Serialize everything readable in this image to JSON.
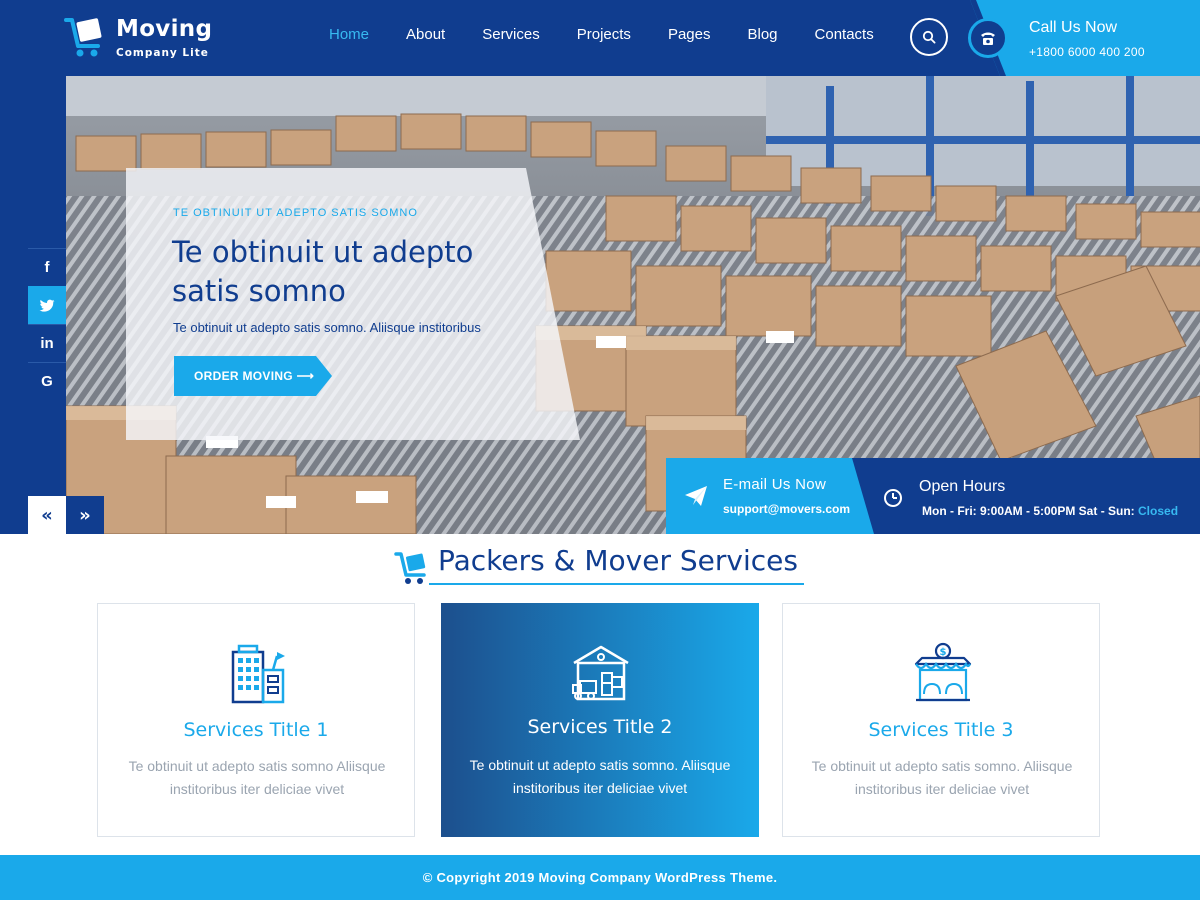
{
  "brand": {
    "name": "Moving",
    "tagline": "Company Lite"
  },
  "nav": {
    "items": [
      "Home",
      "About",
      "Services",
      "Projects",
      "Pages",
      "Blog",
      "Contacts"
    ],
    "active": "Home"
  },
  "call": {
    "title": "Call Us Now",
    "number": "+1800 6000 400 200"
  },
  "social": [
    "facebook-icon",
    "twitter-icon",
    "linkedin-icon",
    "google-icon"
  ],
  "hero": {
    "kicker": "TE OBTINUIT UT ADEPTO SATIS SOMNO",
    "title": "Te obtinuit ut adepto satis somno",
    "text": "Te obtinuit ut adepto satis somno. Aliisque institoribus",
    "button": "ORDER MOVING ⟶"
  },
  "info": {
    "email_title": "E-mail Us Now",
    "email_value": "support@movers.com",
    "hours_title": "Open Hours",
    "hours_value": "Mon - Fri: 9:00AM - 5:00PM Sat - Sun: ",
    "hours_closed": "Closed"
  },
  "services": {
    "title": "Packers & Mover Services",
    "cards": [
      {
        "title": "Services Title 1",
        "text": "Te obtinuit ut adepto satis somno Aliisque institoribus iter deliciae vivet"
      },
      {
        "title": "Services Title 2",
        "text": "Te obtinuit ut adepto satis somno. Aliisque institoribus iter deliciae vivet"
      },
      {
        "title": "Services Title 3",
        "text": "Te obtinuit ut adepto satis somno. Aliisque institoribus iter deliciae vivet"
      }
    ]
  },
  "footer": {
    "copyright": "© Copyright 2019 Moving Company WordPress Theme."
  },
  "colors": {
    "navy": "#103d8f",
    "accent": "#1aa9ea",
    "muted": "#9aa4b0"
  }
}
